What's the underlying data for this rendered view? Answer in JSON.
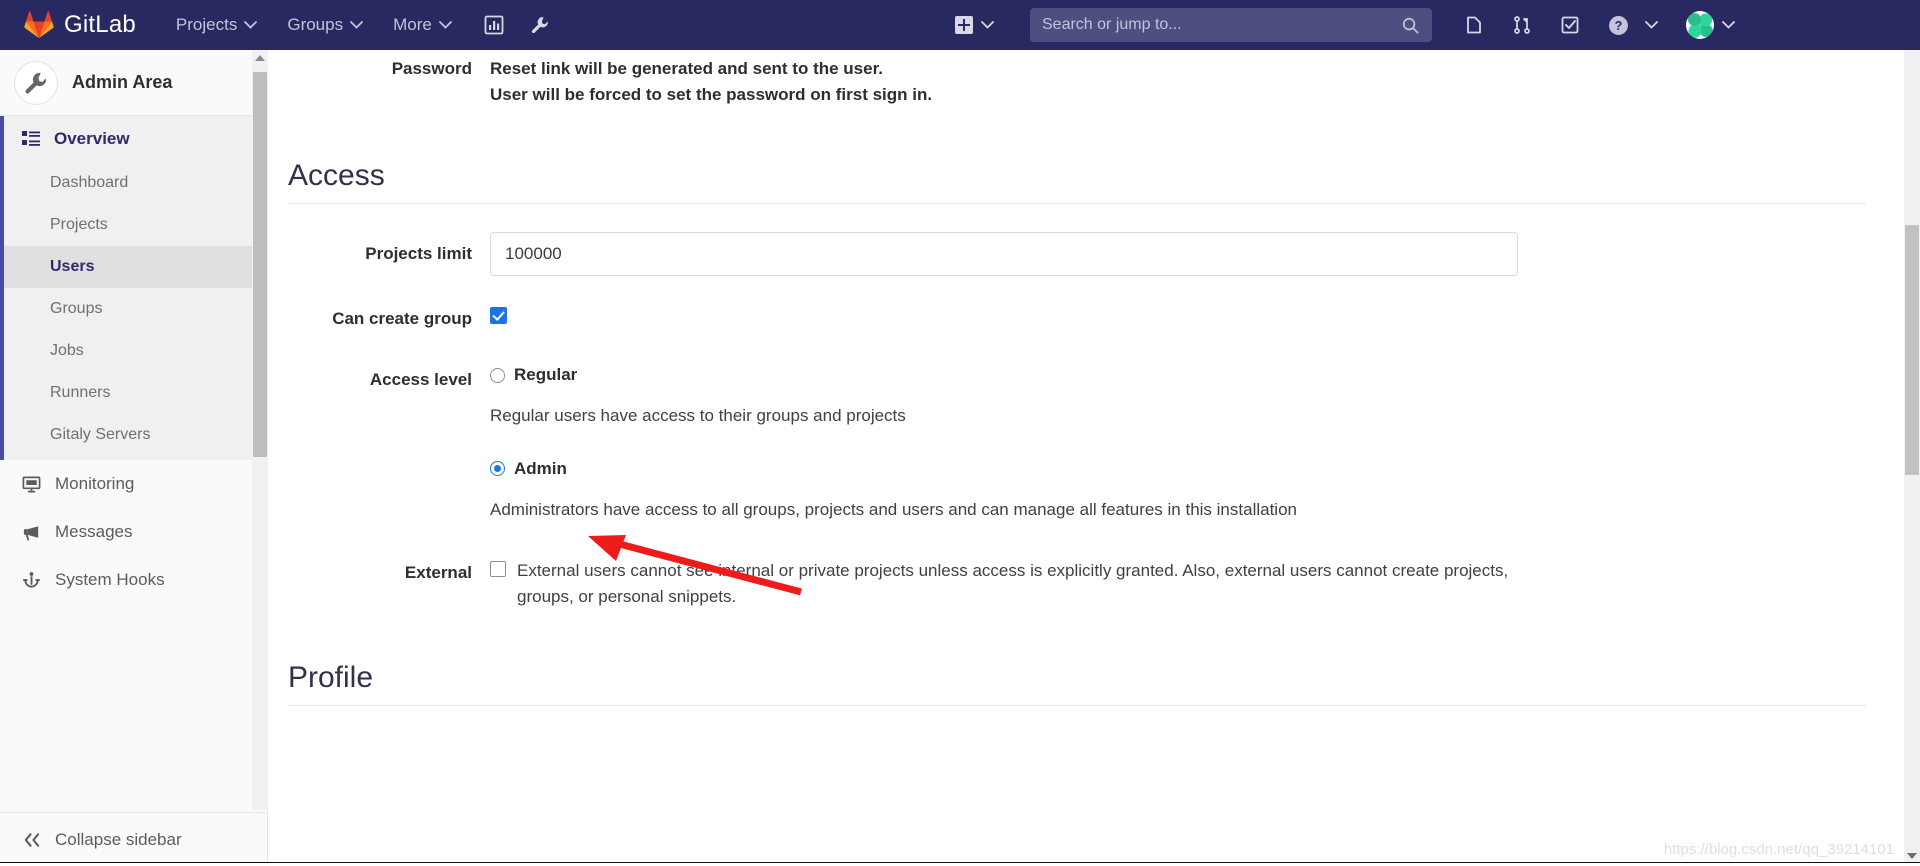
{
  "navbar": {
    "brand": "GitLab",
    "links": [
      {
        "label": "Projects",
        "icon": "chevron-down-icon"
      },
      {
        "label": "Groups",
        "icon": "chevron-down-icon"
      },
      {
        "label": "More",
        "icon": "chevron-down-icon"
      }
    ],
    "left_icons": [
      "analytics-chart-icon",
      "wrench-icon"
    ],
    "new_item_icon": "plus-square-icon",
    "search": {
      "placeholder": "Search or jump to...",
      "value": "",
      "icon": "search-icon"
    },
    "right_icons": [
      "issues-board-icon",
      "merge-requests-icon",
      "todos-icon",
      "help-icon"
    ],
    "avatar_label": "user-avatar",
    "brand_color": "#292961",
    "search_bg": "#4e4e80"
  },
  "sidebar": {
    "title": "Admin Area",
    "title_icon": "wrench-icon",
    "overview": {
      "label": "Overview",
      "icon": "overview-list-icon"
    },
    "sub_items": [
      {
        "label": "Dashboard",
        "active": false
      },
      {
        "label": "Projects",
        "active": false
      },
      {
        "label": "Users",
        "active": true
      },
      {
        "label": "Groups",
        "active": false
      },
      {
        "label": "Jobs",
        "active": false
      },
      {
        "label": "Runners",
        "active": false
      },
      {
        "label": "Gitaly Servers",
        "active": false
      }
    ],
    "plain_items": [
      {
        "label": "Monitoring",
        "icon": "monitor-icon"
      },
      {
        "label": "Messages",
        "icon": "megaphone-icon"
      },
      {
        "label": "System Hooks",
        "icon": "hook-icon"
      }
    ],
    "collapse": {
      "label": "Collapse sidebar",
      "icon": "double-chevron-left-icon"
    },
    "active_color": "#2f2a6b"
  },
  "main": {
    "password": {
      "label": "Password",
      "line1": "Reset link will be generated and sent to the user.",
      "line2": "User will be forced to set the password on first sign in."
    },
    "access": {
      "heading": "Access",
      "projects_limit": {
        "label": "Projects limit",
        "value": "100000"
      },
      "can_create_group": {
        "label": "Can create group",
        "checked": "true"
      },
      "access_level": {
        "label": "Access level",
        "options": [
          {
            "name": "Regular",
            "selected": "false",
            "description": "Regular users have access to their groups and projects"
          },
          {
            "name": "Admin",
            "selected": "true",
            "description": "Administrators have access to all groups, projects and users and can manage all features in this installation"
          }
        ]
      },
      "external": {
        "label": "External",
        "checked": "false",
        "description": "External users cannot see internal or private projects unless access is explicitly granted. Also, external users cannot create projects, groups, or personal snippets."
      }
    },
    "profile": {
      "heading": "Profile"
    }
  },
  "annotation": {
    "type": "red-arrow",
    "color": "#ee1b1b",
    "points_to": "Admin"
  },
  "watermark": {
    "text": "https://blog.csdn.net/qq_39214101"
  }
}
